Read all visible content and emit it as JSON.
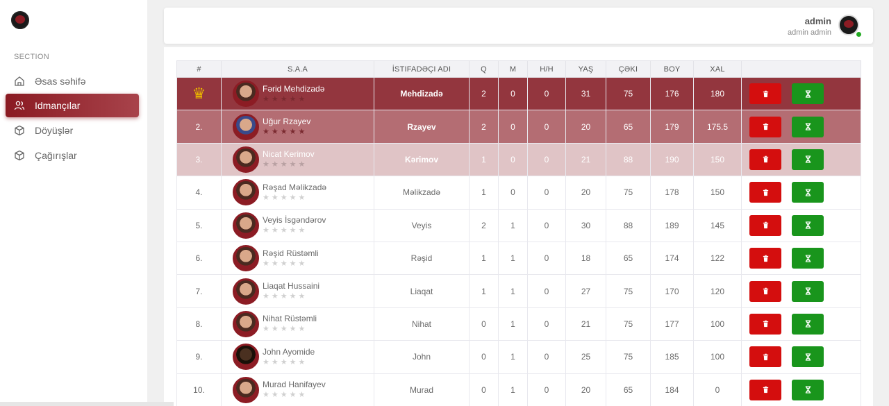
{
  "sidebar": {
    "section_label": "SECTION",
    "items": [
      {
        "label": "Əsas səhifə",
        "icon": "home-icon"
      },
      {
        "label": "Idmançılar",
        "icon": "users-icon",
        "active": true
      },
      {
        "label": "Döyüşlər",
        "icon": "box-icon"
      },
      {
        "label": "Çağırışlar",
        "icon": "box-icon"
      }
    ]
  },
  "header": {
    "user_name": "admin",
    "user_sub": "admin admin"
  },
  "table": {
    "columns": [
      "#",
      "S.A.A",
      "İSTIFADƏÇI ADI",
      "Q",
      "M",
      "H/H",
      "YAŞ",
      "ÇƏKI",
      "BOY",
      "XAL",
      ""
    ],
    "rows": [
      {
        "rank": "",
        "name": "Fərid Mehdizadə",
        "username": "Mehdizadə",
        "q": "2",
        "m": "0",
        "hh": "0",
        "age": "31",
        "weight": "75",
        "height": "176",
        "points": "180"
      },
      {
        "rank": "2.",
        "name": "Uğur Rzayev",
        "username": "Rzayev",
        "q": "2",
        "m": "0",
        "hh": "0",
        "age": "20",
        "weight": "65",
        "height": "179",
        "points": "175.5"
      },
      {
        "rank": "3.",
        "name": "Nicat Kerimov",
        "username": "Kərimov",
        "q": "1",
        "m": "0",
        "hh": "0",
        "age": "21",
        "weight": "88",
        "height": "190",
        "points": "150"
      },
      {
        "rank": "4.",
        "name": "Rəşad Məlikzadə",
        "username": "Məlikzadə",
        "q": "1",
        "m": "0",
        "hh": "0",
        "age": "20",
        "weight": "75",
        "height": "178",
        "points": "150"
      },
      {
        "rank": "5.",
        "name": "Veyis İsgəndərov",
        "username": "Veyis",
        "q": "2",
        "m": "1",
        "hh": "0",
        "age": "30",
        "weight": "88",
        "height": "189",
        "points": "145"
      },
      {
        "rank": "6.",
        "name": "Rəşid Rüstəmli",
        "username": "Rəşid",
        "q": "1",
        "m": "1",
        "hh": "0",
        "age": "18",
        "weight": "65",
        "height": "174",
        "points": "122"
      },
      {
        "rank": "7.",
        "name": "Liaqat Hussaini",
        "username": "Liaqat",
        "q": "1",
        "m": "1",
        "hh": "0",
        "age": "27",
        "weight": "75",
        "height": "170",
        "points": "120"
      },
      {
        "rank": "8.",
        "name": "Nihat Rüstəmli",
        "username": "Nihat",
        "q": "0",
        "m": "1",
        "hh": "0",
        "age": "21",
        "weight": "75",
        "height": "177",
        "points": "100"
      },
      {
        "rank": "9.",
        "name": "John Ayomide",
        "username": "John",
        "q": "0",
        "m": "1",
        "hh": "0",
        "age": "25",
        "weight": "75",
        "height": "185",
        "points": "100"
      },
      {
        "rank": "10.",
        "name": "Murad Hanifayev",
        "username": "Murad",
        "q": "0",
        "m": "1",
        "hh": "0",
        "age": "20",
        "weight": "65",
        "height": "184",
        "points": "0"
      }
    ]
  },
  "icons": {
    "crown": "crown-icon",
    "delete": "trash-icon",
    "timer": "hourglass-icon"
  },
  "colors": {
    "accent": "#8c1c24",
    "danger": "#d40e0e",
    "success": "#19951c"
  }
}
